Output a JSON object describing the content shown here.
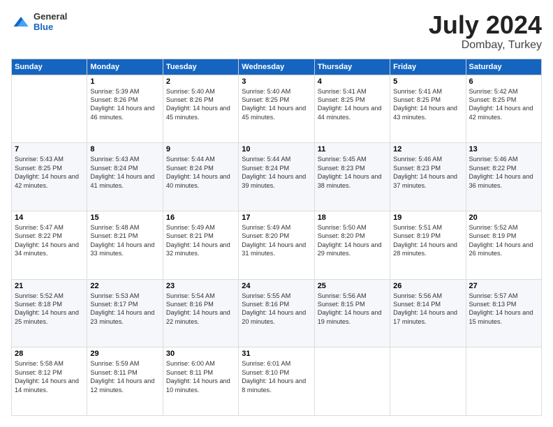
{
  "logo": {
    "general": "General",
    "blue": "Blue"
  },
  "title": "July 2024",
  "location": "Dombay, Turkey",
  "days_header": [
    "Sunday",
    "Monday",
    "Tuesday",
    "Wednesday",
    "Thursday",
    "Friday",
    "Saturday"
  ],
  "weeks": [
    [
      {
        "day": "",
        "sunrise": "",
        "sunset": "",
        "daylight": ""
      },
      {
        "day": "1",
        "sunrise": "Sunrise: 5:39 AM",
        "sunset": "Sunset: 8:26 PM",
        "daylight": "Daylight: 14 hours and 46 minutes."
      },
      {
        "day": "2",
        "sunrise": "Sunrise: 5:40 AM",
        "sunset": "Sunset: 8:26 PM",
        "daylight": "Daylight: 14 hours and 45 minutes."
      },
      {
        "day": "3",
        "sunrise": "Sunrise: 5:40 AM",
        "sunset": "Sunset: 8:25 PM",
        "daylight": "Daylight: 14 hours and 45 minutes."
      },
      {
        "day": "4",
        "sunrise": "Sunrise: 5:41 AM",
        "sunset": "Sunset: 8:25 PM",
        "daylight": "Daylight: 14 hours and 44 minutes."
      },
      {
        "day": "5",
        "sunrise": "Sunrise: 5:41 AM",
        "sunset": "Sunset: 8:25 PM",
        "daylight": "Daylight: 14 hours and 43 minutes."
      },
      {
        "day": "6",
        "sunrise": "Sunrise: 5:42 AM",
        "sunset": "Sunset: 8:25 PM",
        "daylight": "Daylight: 14 hours and 42 minutes."
      }
    ],
    [
      {
        "day": "7",
        "sunrise": "Sunrise: 5:43 AM",
        "sunset": "Sunset: 8:25 PM",
        "daylight": "Daylight: 14 hours and 42 minutes."
      },
      {
        "day": "8",
        "sunrise": "Sunrise: 5:43 AM",
        "sunset": "Sunset: 8:24 PM",
        "daylight": "Daylight: 14 hours and 41 minutes."
      },
      {
        "day": "9",
        "sunrise": "Sunrise: 5:44 AM",
        "sunset": "Sunset: 8:24 PM",
        "daylight": "Daylight: 14 hours and 40 minutes."
      },
      {
        "day": "10",
        "sunrise": "Sunrise: 5:44 AM",
        "sunset": "Sunset: 8:24 PM",
        "daylight": "Daylight: 14 hours and 39 minutes."
      },
      {
        "day": "11",
        "sunrise": "Sunrise: 5:45 AM",
        "sunset": "Sunset: 8:23 PM",
        "daylight": "Daylight: 14 hours and 38 minutes."
      },
      {
        "day": "12",
        "sunrise": "Sunrise: 5:46 AM",
        "sunset": "Sunset: 8:23 PM",
        "daylight": "Daylight: 14 hours and 37 minutes."
      },
      {
        "day": "13",
        "sunrise": "Sunrise: 5:46 AM",
        "sunset": "Sunset: 8:22 PM",
        "daylight": "Daylight: 14 hours and 36 minutes."
      }
    ],
    [
      {
        "day": "14",
        "sunrise": "Sunrise: 5:47 AM",
        "sunset": "Sunset: 8:22 PM",
        "daylight": "Daylight: 14 hours and 34 minutes."
      },
      {
        "day": "15",
        "sunrise": "Sunrise: 5:48 AM",
        "sunset": "Sunset: 8:21 PM",
        "daylight": "Daylight: 14 hours and 33 minutes."
      },
      {
        "day": "16",
        "sunrise": "Sunrise: 5:49 AM",
        "sunset": "Sunset: 8:21 PM",
        "daylight": "Daylight: 14 hours and 32 minutes."
      },
      {
        "day": "17",
        "sunrise": "Sunrise: 5:49 AM",
        "sunset": "Sunset: 8:20 PM",
        "daylight": "Daylight: 14 hours and 31 minutes."
      },
      {
        "day": "18",
        "sunrise": "Sunrise: 5:50 AM",
        "sunset": "Sunset: 8:20 PM",
        "daylight": "Daylight: 14 hours and 29 minutes."
      },
      {
        "day": "19",
        "sunrise": "Sunrise: 5:51 AM",
        "sunset": "Sunset: 8:19 PM",
        "daylight": "Daylight: 14 hours and 28 minutes."
      },
      {
        "day": "20",
        "sunrise": "Sunrise: 5:52 AM",
        "sunset": "Sunset: 8:19 PM",
        "daylight": "Daylight: 14 hours and 26 minutes."
      }
    ],
    [
      {
        "day": "21",
        "sunrise": "Sunrise: 5:52 AM",
        "sunset": "Sunset: 8:18 PM",
        "daylight": "Daylight: 14 hours and 25 minutes."
      },
      {
        "day": "22",
        "sunrise": "Sunrise: 5:53 AM",
        "sunset": "Sunset: 8:17 PM",
        "daylight": "Daylight: 14 hours and 23 minutes."
      },
      {
        "day": "23",
        "sunrise": "Sunrise: 5:54 AM",
        "sunset": "Sunset: 8:16 PM",
        "daylight": "Daylight: 14 hours and 22 minutes."
      },
      {
        "day": "24",
        "sunrise": "Sunrise: 5:55 AM",
        "sunset": "Sunset: 8:16 PM",
        "daylight": "Daylight: 14 hours and 20 minutes."
      },
      {
        "day": "25",
        "sunrise": "Sunrise: 5:56 AM",
        "sunset": "Sunset: 8:15 PM",
        "daylight": "Daylight: 14 hours and 19 minutes."
      },
      {
        "day": "26",
        "sunrise": "Sunrise: 5:56 AM",
        "sunset": "Sunset: 8:14 PM",
        "daylight": "Daylight: 14 hours and 17 minutes."
      },
      {
        "day": "27",
        "sunrise": "Sunrise: 5:57 AM",
        "sunset": "Sunset: 8:13 PM",
        "daylight": "Daylight: 14 hours and 15 minutes."
      }
    ],
    [
      {
        "day": "28",
        "sunrise": "Sunrise: 5:58 AM",
        "sunset": "Sunset: 8:12 PM",
        "daylight": "Daylight: 14 hours and 14 minutes."
      },
      {
        "day": "29",
        "sunrise": "Sunrise: 5:59 AM",
        "sunset": "Sunset: 8:11 PM",
        "daylight": "Daylight: 14 hours and 12 minutes."
      },
      {
        "day": "30",
        "sunrise": "Sunrise: 6:00 AM",
        "sunset": "Sunset: 8:11 PM",
        "daylight": "Daylight: 14 hours and 10 minutes."
      },
      {
        "day": "31",
        "sunrise": "Sunrise: 6:01 AM",
        "sunset": "Sunset: 8:10 PM",
        "daylight": "Daylight: 14 hours and 8 minutes."
      },
      {
        "day": "",
        "sunrise": "",
        "sunset": "",
        "daylight": ""
      },
      {
        "day": "",
        "sunrise": "",
        "sunset": "",
        "daylight": ""
      },
      {
        "day": "",
        "sunrise": "",
        "sunset": "",
        "daylight": ""
      }
    ]
  ]
}
